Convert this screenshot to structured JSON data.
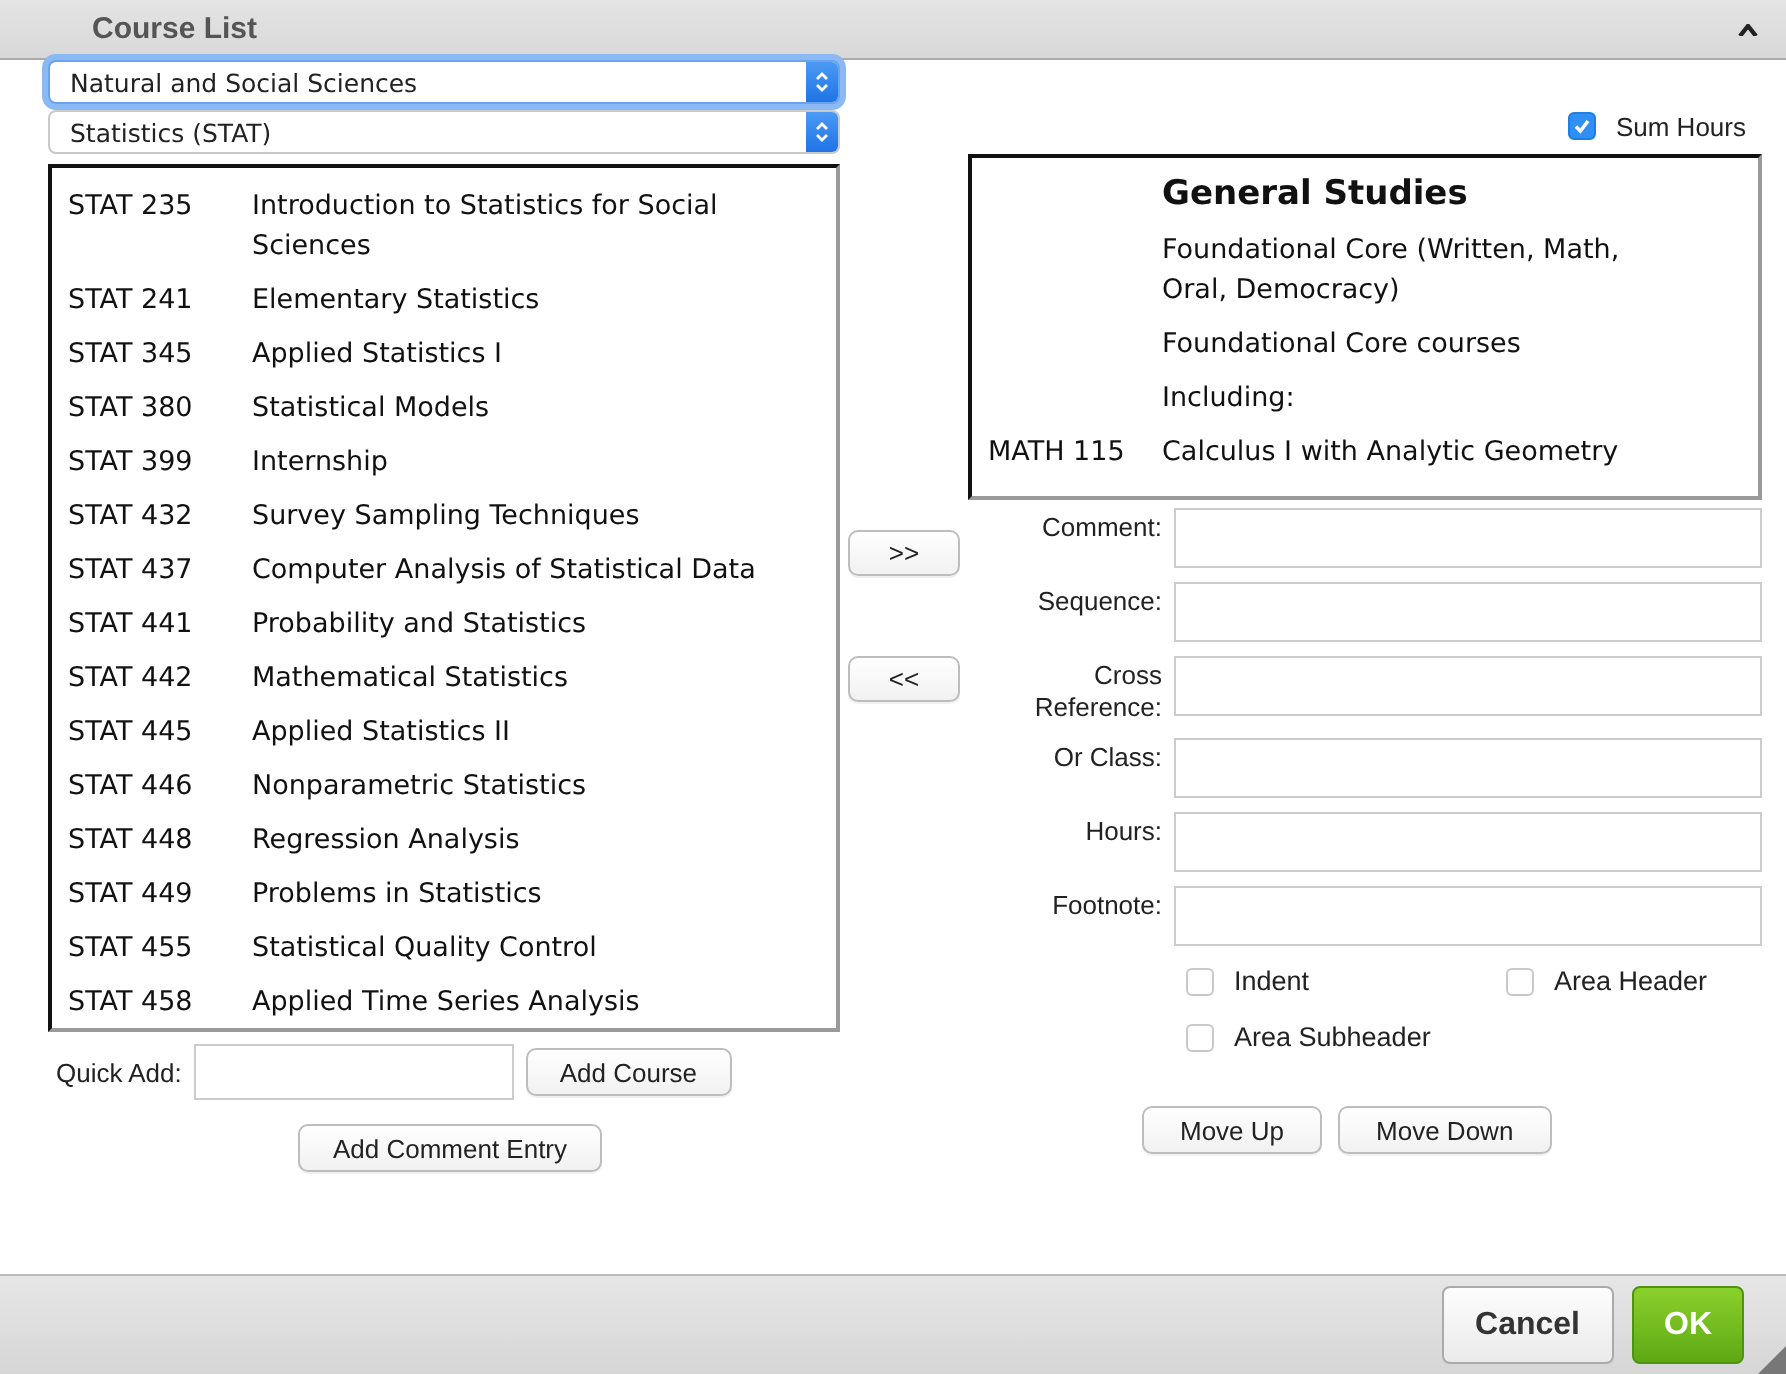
{
  "window": {
    "title": "Course List"
  },
  "category_select": {
    "value": "Natural and Social Sciences",
    "focused": true
  },
  "subject_select": {
    "value": "Statistics (STAT)",
    "focused": false
  },
  "sum_hours": {
    "label": "Sum Hours",
    "checked": true
  },
  "available_courses": [
    {
      "code": "STAT 235",
      "title": "Introduction to Statistics for Social Sciences"
    },
    {
      "code": "STAT 241",
      "title": "Elementary Statistics"
    },
    {
      "code": "STAT 345",
      "title": "Applied Statistics I"
    },
    {
      "code": "STAT 380",
      "title": "Statistical Models"
    },
    {
      "code": "STAT 399",
      "title": "Internship"
    },
    {
      "code": "STAT 432",
      "title": "Survey Sampling Techniques"
    },
    {
      "code": "STAT 437",
      "title": "Computer Analysis of Statistical Data"
    },
    {
      "code": "STAT 441",
      "title": "Probability and Statistics"
    },
    {
      "code": "STAT 442",
      "title": "Mathematical Statistics"
    },
    {
      "code": "STAT 445",
      "title": "Applied Statistics II"
    },
    {
      "code": "STAT 446",
      "title": "Nonparametric Statistics"
    },
    {
      "code": "STAT 448",
      "title": "Regression Analysis"
    },
    {
      "code": "STAT 449",
      "title": "Problems in Statistics"
    },
    {
      "code": "STAT 455",
      "title": "Statistical Quality Control"
    },
    {
      "code": "STAT 458",
      "title": "Applied Time Series Analysis"
    }
  ],
  "selected_courses": [
    {
      "kind": "header",
      "title": "General Studies"
    },
    {
      "kind": "text",
      "title": "Foundational Core (Written, Math, Oral, Democracy)"
    },
    {
      "kind": "text",
      "title": "Foundational Core courses"
    },
    {
      "kind": "text",
      "title": "Including:"
    },
    {
      "kind": "course",
      "code": "MATH 115",
      "title": "Calculus I with Analytic Geometry"
    }
  ],
  "transfer_buttons": [
    ">>",
    "<<"
  ],
  "quick_add": {
    "label": "Quick Add:",
    "button": "Add Course"
  },
  "add_comment_button": "Add Comment Entry",
  "fields": [
    {
      "label": "Comment:"
    },
    {
      "label": "Sequence:"
    },
    {
      "label": "Cross Reference:"
    },
    {
      "label": "Or Class:"
    },
    {
      "label": "Hours:"
    },
    {
      "label": "Footnote:"
    }
  ],
  "options": [
    {
      "label": "Indent",
      "checked": false
    },
    {
      "label": "Area Header",
      "checked": false
    },
    {
      "label": "Area Subheader",
      "checked": false
    }
  ],
  "move_buttons": [
    "Move Up",
    "Move Down"
  ],
  "footer_buttons": [
    {
      "label": "Cancel",
      "kind": "default"
    },
    {
      "label": "OK",
      "kind": "primary"
    }
  ]
}
